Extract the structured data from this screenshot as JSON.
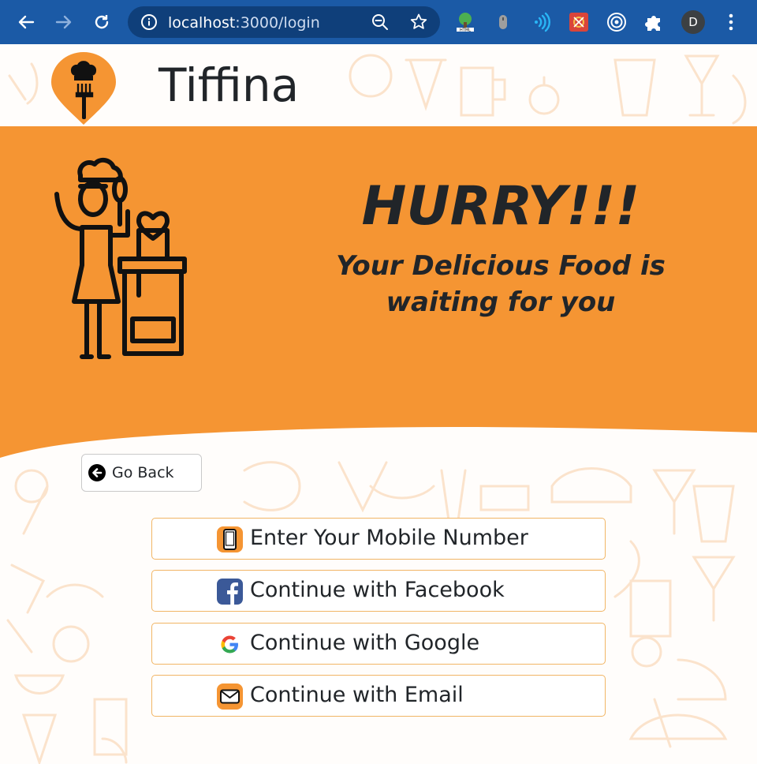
{
  "browser": {
    "url_host": "localhost",
    "url_path": ":3000/login",
    "profile_initial": "D",
    "extension_icons": [
      "html-tree-icon",
      "mouse-icon",
      "wifi-waves-icon",
      "bug-extension-icon",
      "target-icon",
      "puzzle-icon"
    ]
  },
  "header": {
    "brand": "Tiffina"
  },
  "hero": {
    "headline": "HURRY!!!",
    "tagline": "Your Delicious Food is waiting for you"
  },
  "actions": {
    "go_back_label": "Go Back",
    "options": [
      {
        "label": "Enter Your Mobile Number",
        "icon": "mobile-phone-icon"
      },
      {
        "label": "Continue with Facebook",
        "icon": "facebook-icon"
      },
      {
        "label": "Continue with Google",
        "icon": "google-icon"
      },
      {
        "label": "Continue with Email",
        "icon": "email-icon"
      }
    ]
  },
  "colors": {
    "brand_orange": "#f59533",
    "chrome_blue": "#1b5aa6",
    "button_border": "#f1b565",
    "text_dark": "#212529"
  }
}
